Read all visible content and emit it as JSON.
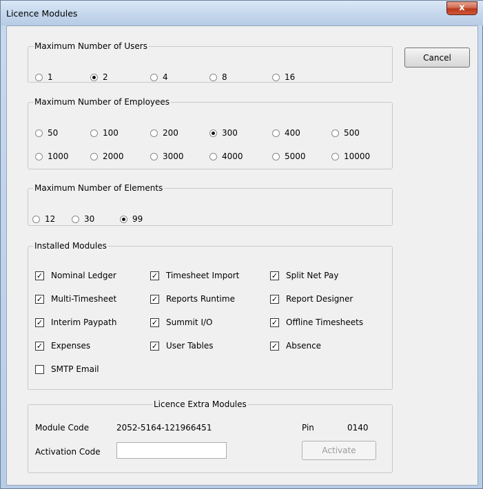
{
  "window": {
    "title": "Licence Modules",
    "close_glyph": "x"
  },
  "buttons": {
    "cancel": "Cancel",
    "activate": "Activate"
  },
  "users": {
    "legend": "Maximum Number of Users",
    "options": [
      {
        "label": "1",
        "selected": false
      },
      {
        "label": "2",
        "selected": true
      },
      {
        "label": "4",
        "selected": false
      },
      {
        "label": "8",
        "selected": false
      },
      {
        "label": "16",
        "selected": false
      }
    ]
  },
  "employees": {
    "legend": "Maximum Number of Employees",
    "options": [
      {
        "label": "50",
        "selected": false
      },
      {
        "label": "100",
        "selected": false
      },
      {
        "label": "200",
        "selected": false
      },
      {
        "label": "300",
        "selected": true
      },
      {
        "label": "400",
        "selected": false
      },
      {
        "label": "500",
        "selected": false
      },
      {
        "label": "1000",
        "selected": false
      },
      {
        "label": "2000",
        "selected": false
      },
      {
        "label": "3000",
        "selected": false
      },
      {
        "label": "4000",
        "selected": false
      },
      {
        "label": "5000",
        "selected": false
      },
      {
        "label": "10000",
        "selected": false
      }
    ]
  },
  "elements": {
    "legend": "Maximum Number of Elements",
    "options": [
      {
        "label": "12",
        "selected": false
      },
      {
        "label": "30",
        "selected": false
      },
      {
        "label": "99",
        "selected": true
      }
    ]
  },
  "modules": {
    "legend": "Installed Modules",
    "items": [
      {
        "label": "Nominal Ledger",
        "checked": true
      },
      {
        "label": "Timesheet Import",
        "checked": true
      },
      {
        "label": "Split Net Pay",
        "checked": true
      },
      {
        "label": "Multi-Timesheet",
        "checked": true
      },
      {
        "label": "Reports Runtime",
        "checked": true
      },
      {
        "label": "Report Designer",
        "checked": true
      },
      {
        "label": "Interim Paypath",
        "checked": true
      },
      {
        "label": "Summit I/O",
        "checked": true
      },
      {
        "label": "Offline Timesheets",
        "checked": true
      },
      {
        "label": "Expenses",
        "checked": true
      },
      {
        "label": "User Tables",
        "checked": true
      },
      {
        "label": "Absence",
        "checked": true
      },
      {
        "label": "SMTP Email",
        "checked": false
      }
    ]
  },
  "extra": {
    "legend": "Licence Extra Modules",
    "module_code_label": "Module Code",
    "module_code_value": "2052-5164-121966451",
    "pin_label": "Pin",
    "pin_value": "0140",
    "activation_label": "Activation Code",
    "activation_value": ""
  }
}
